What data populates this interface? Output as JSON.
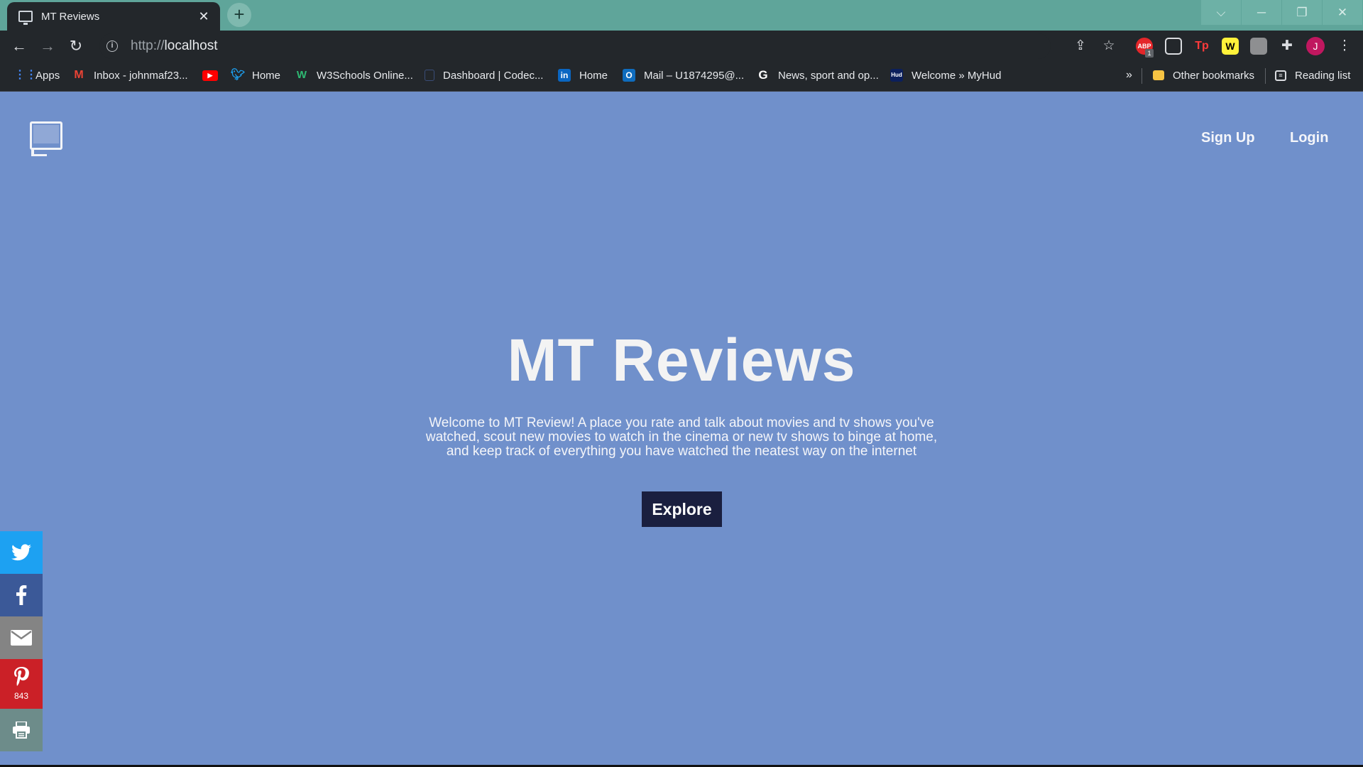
{
  "browser": {
    "tab": {
      "title": "MT Reviews",
      "close": "✕"
    },
    "new_tab": "+",
    "window_controls": {
      "search_tabs": "⌵",
      "minimize": "─",
      "restore": "❐",
      "close": "✕"
    },
    "toolbar": {
      "back": "←",
      "forward": "→",
      "reload": "↻",
      "url_scheme": "http://",
      "url_host": "localhost"
    },
    "extensions": {
      "abp": "ABP",
      "abp_badge": "1",
      "tp": "Tp",
      "w": "W",
      "profile_initial": "J"
    },
    "bookmarks": [
      {
        "label": "Apps",
        "icon": "apps-grid-icon"
      },
      {
        "label": "Inbox - johnmaf23...",
        "icon": "gmail-icon"
      },
      {
        "label": "",
        "icon": "youtube-icon"
      },
      {
        "label": "Home",
        "icon": "twitter-icon"
      },
      {
        "label": "W3Schools Online...",
        "icon": "w3schools-icon"
      },
      {
        "label": "Dashboard | Codec...",
        "icon": "codecademy-icon"
      },
      {
        "label": "Home",
        "icon": "linkedin-icon"
      },
      {
        "label": "Mail – U1874295@...",
        "icon": "outlook-icon"
      },
      {
        "label": "News, sport and op...",
        "icon": "guardian-icon"
      },
      {
        "label": "Welcome » MyHud",
        "icon": "myhud-icon"
      }
    ],
    "bookmarks_more": "»",
    "other_bookmarks": "Other bookmarks",
    "reading_list": "Reading list"
  },
  "site": {
    "nav": {
      "signup": "Sign Up",
      "login": "Login"
    },
    "hero": {
      "title": "MT Reviews",
      "text": "Welcome to MT Review! A place you rate and talk about movies and tv shows you've watched, scout new movies to watch in the cinema or new tv shows to binge at home, and keep track of everything you have watched the neatest way on the internet",
      "button": "Explore"
    },
    "share": {
      "pinterest_count": "843",
      "colors": {
        "twitter": "#1da1f2",
        "facebook": "#3b5998",
        "email": "#848484",
        "pinterest": "#cb2027",
        "print": "#6d8c8a"
      }
    },
    "colors": {
      "background": "#7090cb",
      "button": "#1a1f3f"
    }
  }
}
